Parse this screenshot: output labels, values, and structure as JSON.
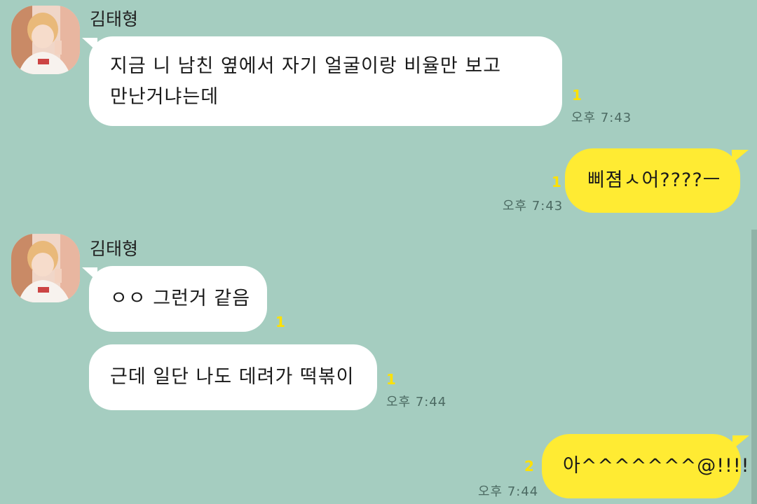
{
  "colors": {
    "background": "#a5cdc0",
    "incoming_bubble": "#ffffff",
    "outgoing_bubble": "#ffeb33",
    "unread_mark": "#ffe100"
  },
  "messages": [
    {
      "sender": "김태형",
      "direction": "incoming",
      "lines": [
        "지금 니 남친 옆에서 자기 얼굴이랑 비율만 보고",
        "만난거냐는데"
      ],
      "unread": "1",
      "time": "오후 7:43"
    },
    {
      "direction": "outgoing",
      "text": "삐졈ㅅ어????ㅡ",
      "unread": "1",
      "time": "오후 7:43"
    },
    {
      "sender": "김태형",
      "direction": "incoming",
      "text": "ㅇㅇ 그런거 같음",
      "unread": "1"
    },
    {
      "direction": "incoming",
      "text": "근데 일단 나도 데려가 떡볶이",
      "unread": "1",
      "time": "오후 7:44"
    },
    {
      "direction": "outgoing",
      "text": "아^^^^^^^@!!!!!!!",
      "unread": "2",
      "time": "오후 7:44"
    }
  ]
}
